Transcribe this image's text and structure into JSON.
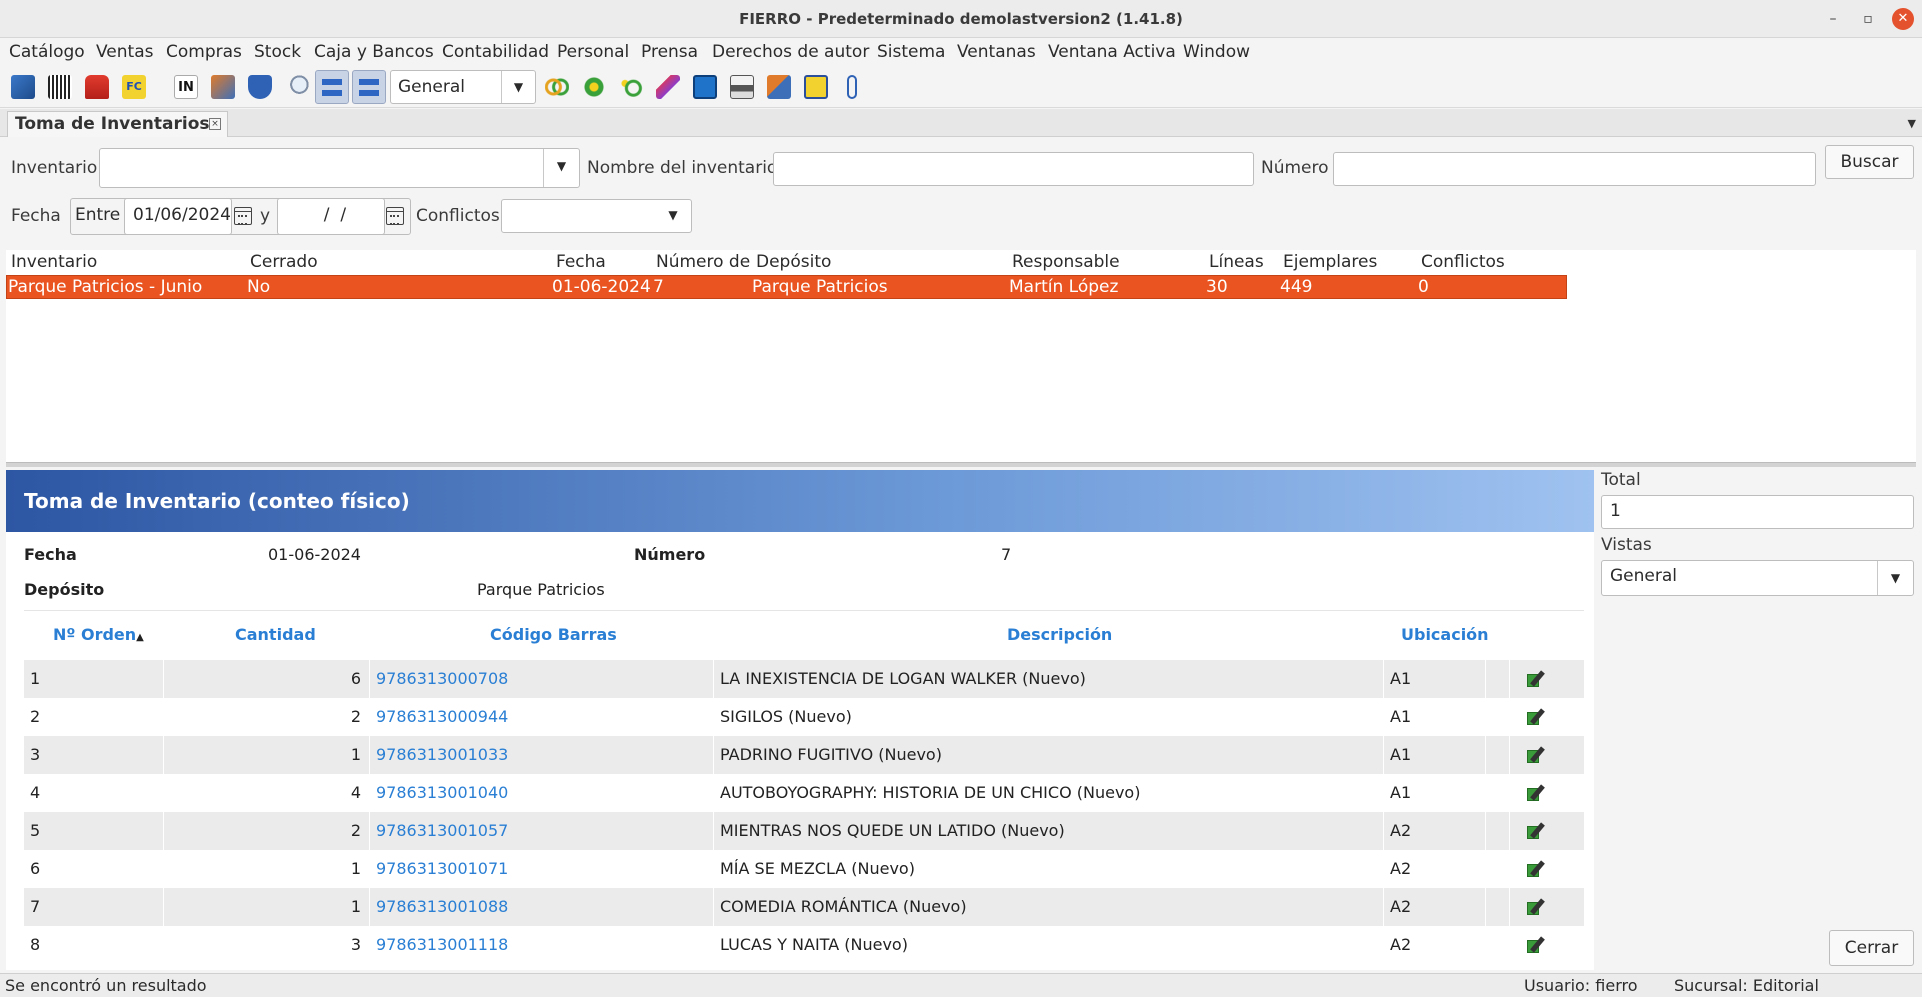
{
  "window": {
    "title": "FIERRO - Predeterminado demolastversion2 (1.41.8)",
    "minimize_label": "–",
    "maximize_label": "▫",
    "close_label": "✕"
  },
  "menu": [
    "Catálogo",
    "Ventas",
    "Compras",
    "Stock",
    "Caja y Bancos",
    "Contabilidad",
    "Personal",
    "Prensa",
    "Derechos de autor",
    "Sistema",
    "Ventanas",
    "Ventana Activa",
    "Window"
  ],
  "toolbar": {
    "view_select": "General"
  },
  "tab": {
    "label": "Toma de Inventarios",
    "close": "×"
  },
  "filters": {
    "inventario_label": "Inventario",
    "inventario_value": "",
    "nombre_label": "Nombre del inventario",
    "nombre_value": "",
    "numero_label": "Número",
    "numero_value": "",
    "buscar_button": "Buscar",
    "fecha_label": "Fecha",
    "entre_label": "Entre",
    "fecha_desde": "01/06/2024",
    "y_label": "y",
    "fecha_hasta": "  /  /",
    "conflictos_label": "Conflictos",
    "conflictos_value": ""
  },
  "list": {
    "columns": [
      "Inventario",
      "Cerrado",
      "Fecha",
      "Número de",
      "Depósito",
      "Responsable",
      "Líneas",
      "Ejemplares",
      "Conflictos"
    ],
    "rows": [
      [
        "Parque Patricios - Junio",
        "No",
        "01-06-2024",
        "7",
        "Parque Patricios",
        "Martín López",
        "30",
        "449",
        "0"
      ]
    ]
  },
  "report": {
    "title": "Toma de Inventario (conteo físico)",
    "fecha_label": "Fecha",
    "fecha_value": "01-06-2024",
    "numero_label": "Número",
    "numero_value": "7",
    "deposito_label": "Depósito",
    "deposito_value": "Parque Patricios",
    "columns": [
      "Nº Orden",
      "Cantidad",
      "Código Barras",
      "Descripción",
      "Ubicación"
    ],
    "sort_indicator": "▲",
    "rows": [
      [
        "1",
        "6",
        "9786313000708",
        "LA INEXISTENCIA DE LOGAN WALKER (Nuevo)",
        "A1"
      ],
      [
        "2",
        "2",
        "9786313000944",
        "SIGILOS (Nuevo)",
        "A1"
      ],
      [
        "3",
        "1",
        "9786313001033",
        "PADRINO FUGITIVO (Nuevo)",
        "A1"
      ],
      [
        "4",
        "4",
        "9786313001040",
        "AUTOBOYOGRAPHY: HISTORIA DE UN CHICO (Nuevo)",
        "A1"
      ],
      [
        "5",
        "2",
        "9786313001057",
        "MIENTRAS NOS QUEDE UN LATIDO (Nuevo)",
        "A2"
      ],
      [
        "6",
        "1",
        "9786313001071",
        "MÍA SE MEZCLA (Nuevo)",
        "A2"
      ],
      [
        "7",
        "1",
        "9786313001088",
        "COMEDIA ROMÁNTICA (Nuevo)",
        "A2"
      ],
      [
        "8",
        "3",
        "9786313001118",
        "LUCAS Y NAITA (Nuevo)",
        "A2"
      ]
    ]
  },
  "side": {
    "total_label": "Total",
    "total_value": "1",
    "vistas_label": "Vistas",
    "vistas_value": "General",
    "cerrar_button": "Cerrar"
  },
  "status": {
    "message": "Se encontró un resultado",
    "usuario": "Usuario: fierro",
    "sucursal": "Sucursal: Editorial"
  },
  "colors": {
    "selection": "#e95420",
    "link": "#2a7fd4",
    "banner_start": "#2d56a3",
    "banner_end": "#9fc2f0"
  }
}
